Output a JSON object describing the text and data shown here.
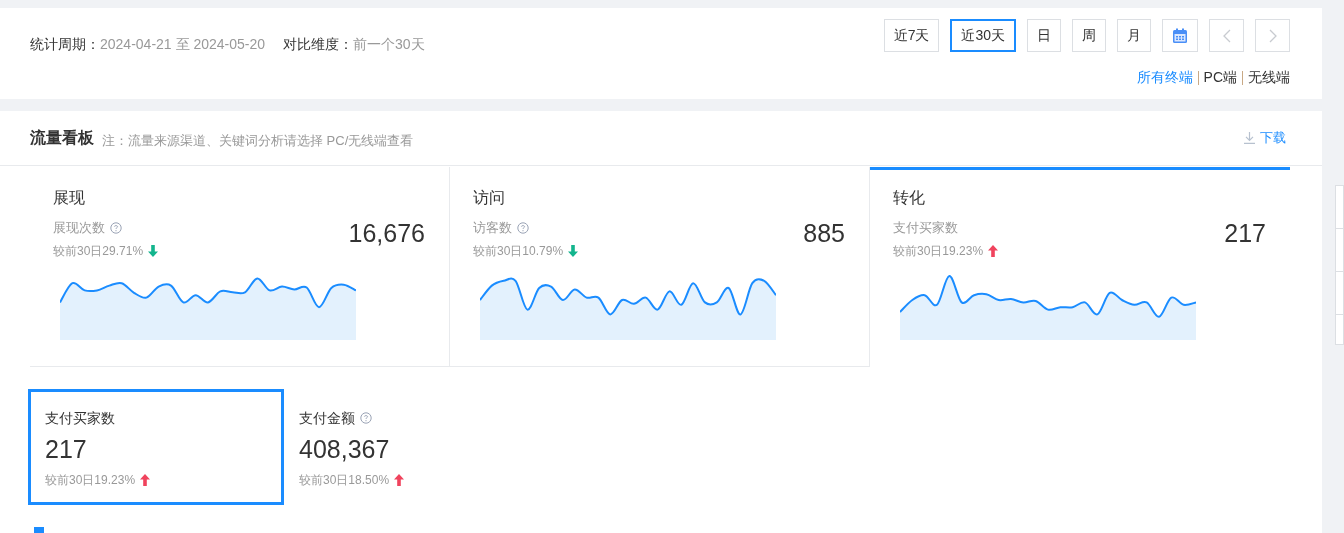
{
  "period": {
    "label": "统计周期：",
    "value": "2024-04-21 至 2024-05-20"
  },
  "compare": {
    "label": "对比维度：",
    "value": "前一个30天"
  },
  "range_buttons": [
    {
      "kind": "text",
      "label": "近7天",
      "selected": false,
      "disabled": false
    },
    {
      "kind": "text",
      "label": "近30天",
      "selected": true,
      "disabled": false
    },
    {
      "kind": "text",
      "label": "日",
      "selected": false,
      "disabled": false
    },
    {
      "kind": "text",
      "label": "周",
      "selected": false,
      "disabled": false
    },
    {
      "kind": "text",
      "label": "月",
      "selected": false,
      "disabled": false
    },
    {
      "kind": "calendar",
      "selected": false,
      "disabled": false
    },
    {
      "kind": "prev",
      "selected": false,
      "disabled": true
    },
    {
      "kind": "next",
      "selected": false,
      "disabled": true
    }
  ],
  "terminals": [
    {
      "label": "所有终端",
      "selected": true
    },
    {
      "label": "PC端",
      "selected": false
    },
    {
      "label": "无线端",
      "selected": false
    }
  ],
  "board": {
    "title": "流量看板",
    "note": "注：流量来源渠道、关键词分析请选择 PC/无线端查看",
    "download": "下载"
  },
  "tabs": [
    {
      "title": "展现",
      "metric": "展现次数",
      "help": true,
      "value": "16,676",
      "change": "较前30日29.71%",
      "kind": "down",
      "selected": false
    },
    {
      "title": "访问",
      "metric": "访客数",
      "help": true,
      "value": "885",
      "change": "较前30日10.79%",
      "kind": "down",
      "selected": false
    },
    {
      "title": "转化",
      "metric": "支付买家数",
      "help": false,
      "value": "217",
      "change": "较前30日19.23%",
      "kind": "up",
      "selected": true
    }
  ],
  "metrics": [
    {
      "label": "支付买家数",
      "help": false,
      "value": "217",
      "change": "较前30日19.23%",
      "kind": "up",
      "selected": true
    },
    {
      "label": "支付金额",
      "help": true,
      "value": "408,367",
      "change": "较前30日18.50%",
      "kind": "up",
      "selected": false
    }
  ]
}
